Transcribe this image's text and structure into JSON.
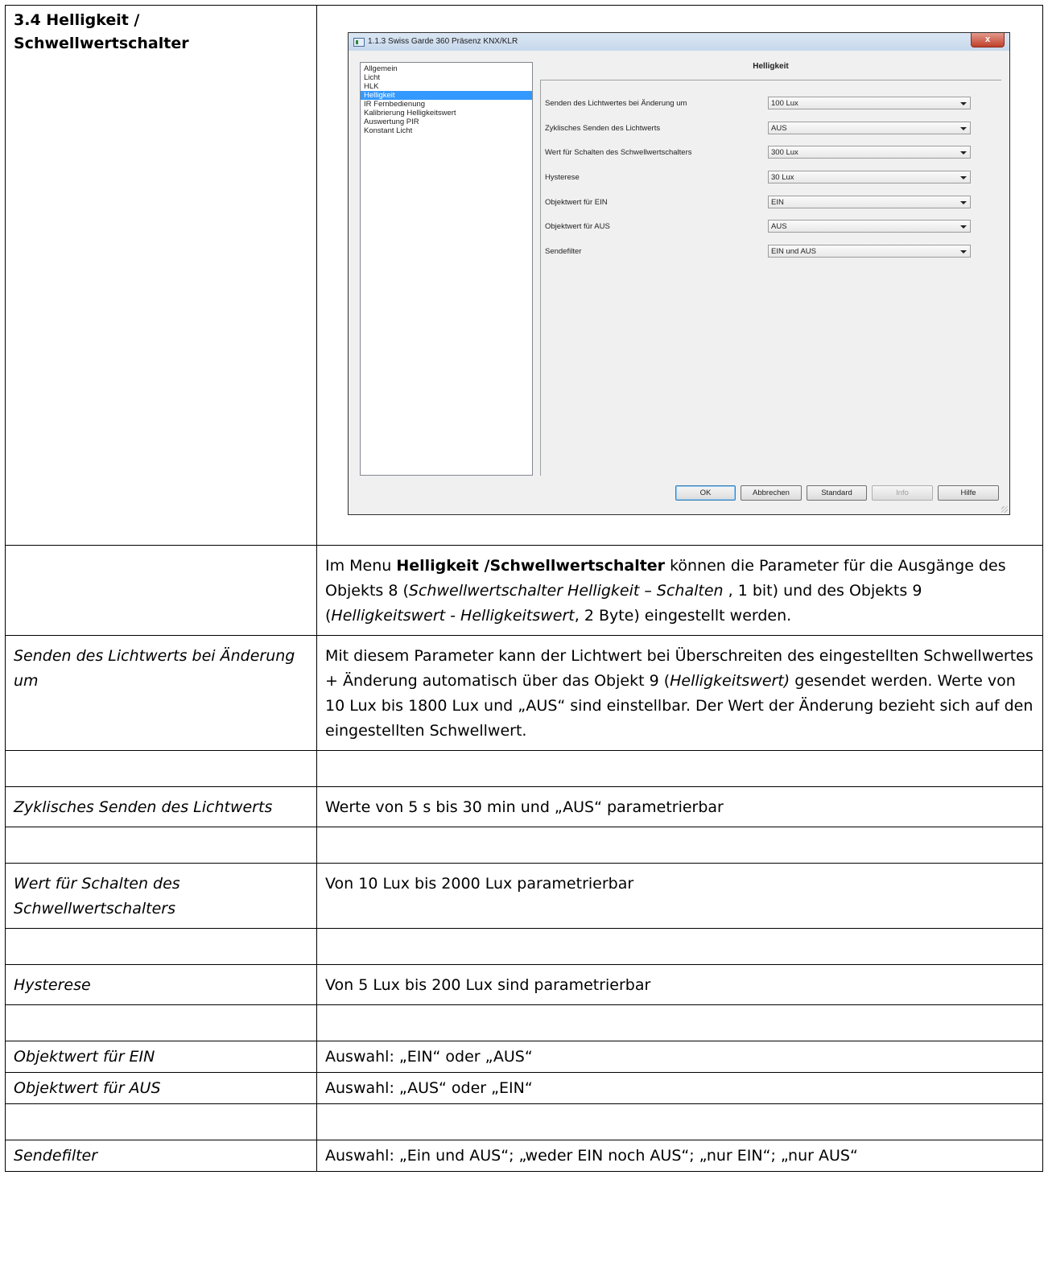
{
  "section": {
    "heading_line1": "3.4  Helligkeit /",
    "heading_line2": "Schwellwertschalter"
  },
  "dialog": {
    "title": "1.1.3 Swiss Garde 360 Präsenz KNX/KLR",
    "close_label": "x",
    "nav_items": [
      "Allgemein",
      "Licht",
      "HLK",
      "Helligkeit",
      "IR Fernbedienung",
      "Kalibrierung Helligkeitswert",
      "Auswertung PIR",
      "Konstant Licht"
    ],
    "selected_nav": "Helligkeit",
    "pane_title": "Helligkeit",
    "params": [
      {
        "label": "Senden des Lichtwertes bei Änderung um",
        "value": "100 Lux"
      },
      {
        "label": "Zyklisches Senden des Lichtwerts",
        "value": "AUS"
      },
      {
        "label": "Wert für Schalten des Schwellwertschalters",
        "value": "300 Lux"
      },
      {
        "label": "Hysterese",
        "value": "30 Lux"
      },
      {
        "label": "Objektwert für EIN",
        "value": "EIN"
      },
      {
        "label": "Objektwert für AUS",
        "value": "AUS"
      },
      {
        "label": "Sendefilter",
        "value": "EIN und AUS"
      }
    ],
    "buttons": {
      "ok": "OK",
      "cancel": "Abbrechen",
      "standard": "Standard",
      "info": "Info",
      "help": "Hilfe"
    }
  },
  "intro": {
    "t1": "Im Menu ",
    "t2": "Helligkeit /Schwellwertschalter",
    "t3": " können die Parameter für die Ausgänge des Objekts 8 (",
    "t4": "Schwellwertschalter Helligkeit – Schalten",
    "t5": " , 1 bit) und des Objekts 9 (",
    "t6": "Helligkeitswert - Helligkeitswert",
    "t7": ", 2 Byte) eingestellt werden."
  },
  "rows": {
    "senden": {
      "left": "Senden des Lichtwerts bei Änderung um",
      "r1": "Mit diesem Parameter kann der Lichtwert bei Überschreiten des eingestellten Schwellwertes + Änderung automatisch über das Objekt 9 (",
      "r2": "Helligkeitswert)",
      "r3": " gesendet werden.   Werte von 10 Lux bis 1800 Lux und  „AUS“  sind einstellbar. Der Wert der Änderung bezieht sich auf den eingestellten Schwellwert."
    },
    "zyklisch": {
      "left": "Zyklisches Senden des Lichtwerts",
      "right": "Werte von 5 s bis 30 min und  „AUS“  parametrierbar"
    },
    "wert": {
      "left": "Wert für Schalten des Schwellwertschalters",
      "right": "Von 10 Lux bis 2000 Lux parametrierbar"
    },
    "hysterese": {
      "left": "Hysterese",
      "right": "Von 5 Lux bis 200 Lux sind parametrierbar"
    },
    "ein": {
      "left": "Objektwert für EIN",
      "right": "Auswahl:  „EIN“ oder „AUS“"
    },
    "aus": {
      "left": "Objektwert für AUS",
      "right": "Auswahl:  „AUS“ oder „EIN“"
    },
    "filter": {
      "left": "Sendefilter",
      "right": "Auswahl:  „Ein und AUS“;  „weder EIN noch AUS“;  „nur EIN“; „nur AUS“"
    }
  }
}
